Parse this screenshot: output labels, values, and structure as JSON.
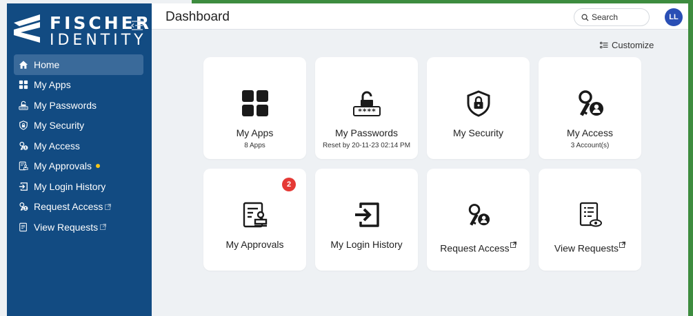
{
  "brand": {
    "line1": "FISCHER",
    "line2": "IDENTITY"
  },
  "sidebar": {
    "items": [
      {
        "label": "Home",
        "icon": "home-icon"
      },
      {
        "label": "My Apps",
        "icon": "grid-icon"
      },
      {
        "label": "My Passwords",
        "icon": "password-lock-icon"
      },
      {
        "label": "My Security",
        "icon": "shield-lock-icon"
      },
      {
        "label": "My Access",
        "icon": "key-user-icon"
      },
      {
        "label": "My Approvals",
        "icon": "approval-icon"
      },
      {
        "label": "My Login History",
        "icon": "login-icon"
      },
      {
        "label": "Request Access",
        "icon": "key-user-icon"
      },
      {
        "label": "View Requests",
        "icon": "view-requests-icon"
      }
    ]
  },
  "header": {
    "title": "Dashboard",
    "search_label": "Search",
    "avatar_initials": "LL"
  },
  "customize_label": "Customize",
  "cards": [
    {
      "title": "My Apps",
      "subtitle": "8 Apps",
      "icon": "grid-icon"
    },
    {
      "title": "My Passwords",
      "subtitle": "Reset by 20-11-23 02:14 PM",
      "icon": "password-lock-icon"
    },
    {
      "title": "My Security",
      "subtitle": "",
      "icon": "shield-lock-icon"
    },
    {
      "title": "My Access",
      "subtitle": "3 Account(s)",
      "icon": "key-user-icon"
    },
    {
      "title": "My Approvals",
      "subtitle": "",
      "icon": "approval-icon",
      "badge": "2"
    },
    {
      "title": "My Login History",
      "subtitle": "",
      "icon": "login-icon"
    },
    {
      "title": "Request Access",
      "subtitle": "",
      "icon": "key-user-icon"
    },
    {
      "title": "View Requests",
      "subtitle": "",
      "icon": "view-requests-icon"
    }
  ],
  "colors": {
    "sidebar_bg": "#124b82",
    "sidebar_active": "#3a6a9a",
    "accent_green": "#3d8c3f",
    "badge_red": "#e53935",
    "avatar_blue": "#2a4fb5",
    "approval_dot": "#f5c518"
  }
}
